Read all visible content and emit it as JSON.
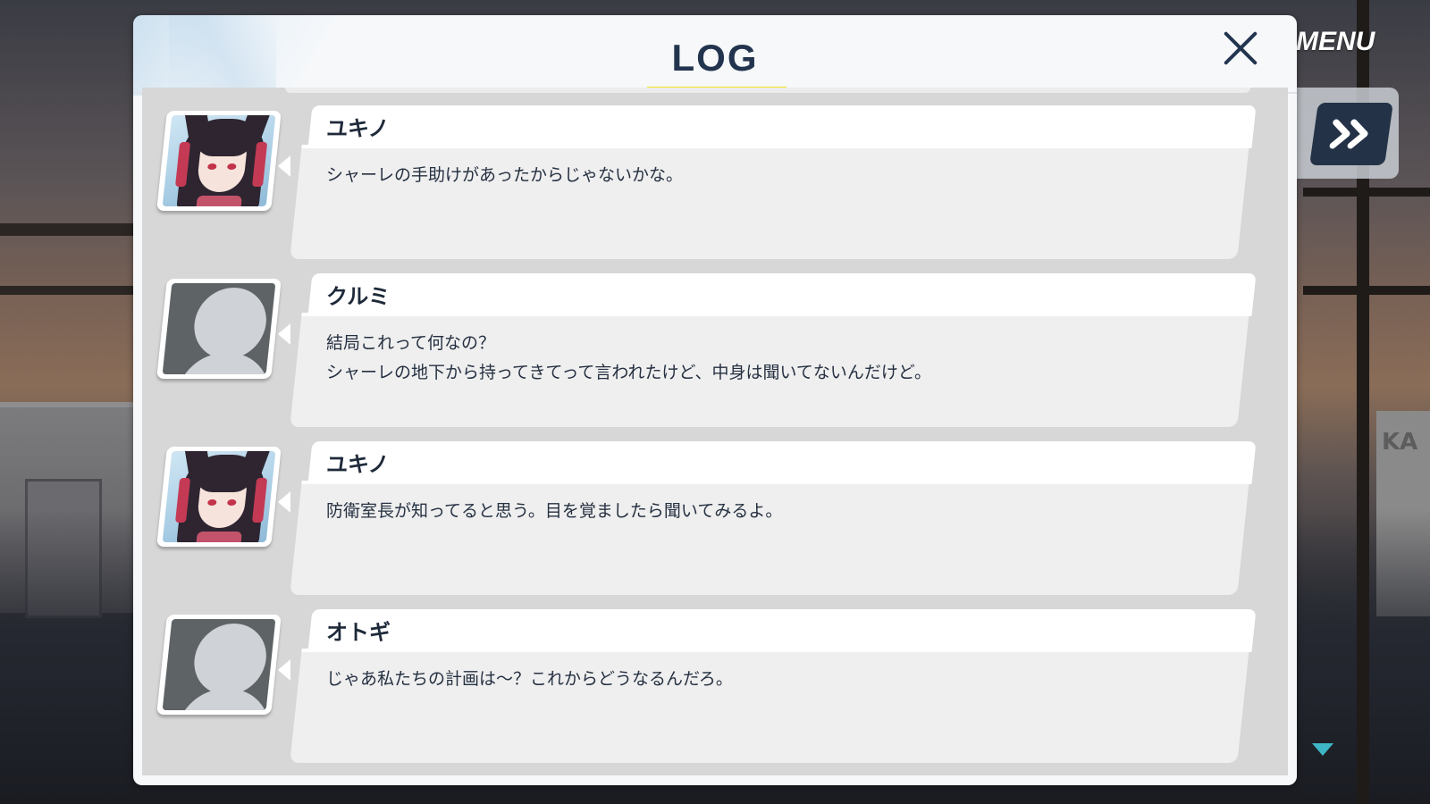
{
  "header": {
    "title": "LOG",
    "close_icon": "close-icon"
  },
  "hud": {
    "menu_label": "MENU",
    "skip_icon": "fast-forward-icon",
    "scroll_down_icon": "triangle-down-icon",
    "accent_color": "#f3e623",
    "arrow_color": "#3fb6c6"
  },
  "background": {
    "sign_text": "KA"
  },
  "log": {
    "entries": [
      {
        "speaker": "ユキノ",
        "avatar": "portrait",
        "text": "シャーレの手助けがあったからじゃないかな。"
      },
      {
        "speaker": "クルミ",
        "avatar": "blank",
        "text": "結局これって何なの？\nシャーレの地下から持ってきてって言われたけど、中身は聞いてないんだけど。"
      },
      {
        "speaker": "ユキノ",
        "avatar": "portrait",
        "text": "防衛室長が知ってると思う。目を覚ましたら聞いてみるよ。"
      },
      {
        "speaker": "オトギ",
        "avatar": "blank",
        "text": "じゃあ私たちの計画は～？これからどうなるんだろ。"
      }
    ]
  }
}
